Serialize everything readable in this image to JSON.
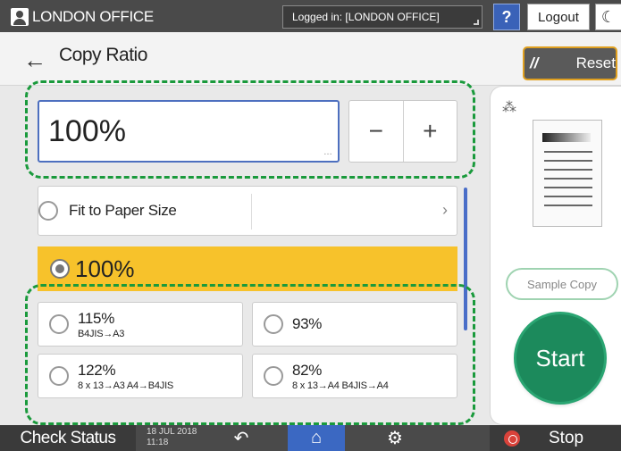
{
  "header": {
    "user_label": "LONDON OFFICE",
    "login_status": "Logged in: [LONDON OFFICE]",
    "help_label": "?",
    "logout_label": "Logout"
  },
  "title_bar": {
    "back_glyph": "←",
    "title": "Copy Ratio",
    "reset_label": "Reset"
  },
  "ratio": {
    "value": "100%",
    "minus": "−",
    "plus": "+"
  },
  "fit_to_paper": {
    "label": "Fit to Paper Size",
    "chevron": "›"
  },
  "selected_ratio": {
    "label": "100%"
  },
  "options": [
    {
      "percent": "115%",
      "detail": "B4JIS→A3"
    },
    {
      "percent": "93%",
      "detail": ""
    },
    {
      "percent": "122%",
      "detail": "8 x 13→A3   A4→B4JIS"
    },
    {
      "percent": "82%",
      "detail": "8 x 13→A4   B4JIS→A4"
    }
  ],
  "right_panel": {
    "sample_copy_label": "Sample Copy",
    "start_label": "Start"
  },
  "bottom_bar": {
    "check_status_label": "Check Status",
    "date": "18 JUL 2018",
    "time": "11:18",
    "stop_label": "Stop"
  },
  "icons": {
    "user": "user-icon",
    "back": "arrow-left-icon",
    "reset": "pencil-icon",
    "toner": "toner-icon",
    "undo": "undo-icon",
    "home": "home-icon",
    "settings": "gear-icon",
    "stop": "stop-icon",
    "moon": "moon-icon"
  },
  "colors": {
    "accent": "#3b68c2",
    "selected": "#f7c22b",
    "start": "#1c8a5c",
    "highlight_dash": "#1a9a3c",
    "reset_border": "#e0a020"
  }
}
